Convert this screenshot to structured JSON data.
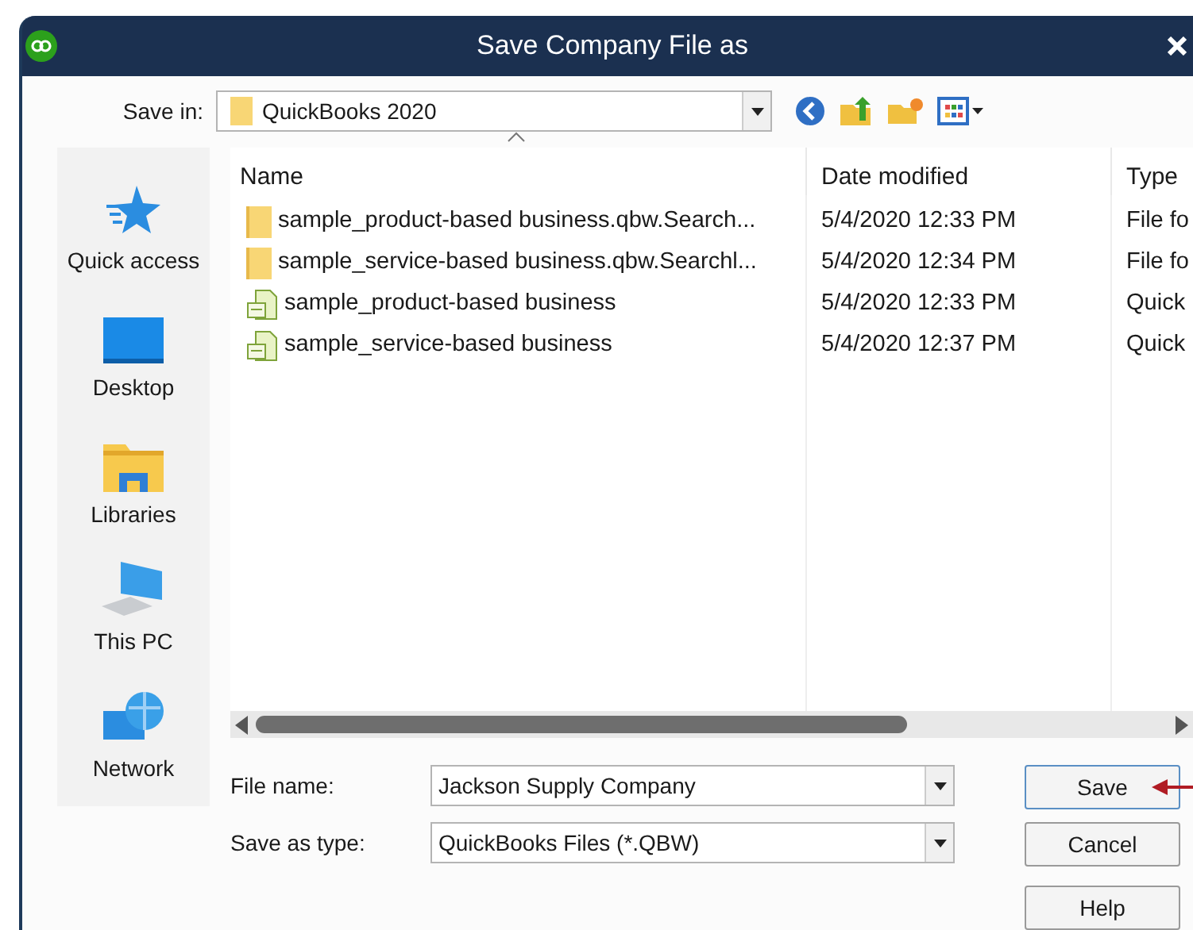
{
  "window": {
    "title": "Save Company File as"
  },
  "save_in": {
    "label": "Save in:",
    "value": "QuickBooks 2020"
  },
  "places": [
    {
      "label": "Quick access",
      "kind": "star"
    },
    {
      "label": "Desktop",
      "kind": "desktop"
    },
    {
      "label": "Libraries",
      "kind": "libraries"
    },
    {
      "label": "This PC",
      "kind": "pc"
    },
    {
      "label": "Network",
      "kind": "network"
    }
  ],
  "table": {
    "columns": [
      "Name",
      "Date modified",
      "Type"
    ],
    "rows": [
      {
        "kind": "folder",
        "name": "sample_product-based business.qbw.Search...",
        "date": "5/4/2020 12:33 PM",
        "type": "File fo"
      },
      {
        "kind": "folder",
        "name": "sample_service-based business.qbw.Searchl...",
        "date": "5/4/2020 12:34 PM",
        "type": "File fo"
      },
      {
        "kind": "qbw",
        "name": "sample_product-based business",
        "date": "5/4/2020 12:33 PM",
        "type": "Quick"
      },
      {
        "kind": "qbw",
        "name": "sample_service-based business",
        "date": "5/4/2020 12:37 PM",
        "type": "Quick"
      }
    ]
  },
  "file_name": {
    "label": "File name:",
    "value": "Jackson Supply Company"
  },
  "save_as_type": {
    "label": "Save as type:",
    "value": "QuickBooks Files (*.QBW)"
  },
  "buttons": [
    "Save",
    "Cancel",
    "Help"
  ]
}
